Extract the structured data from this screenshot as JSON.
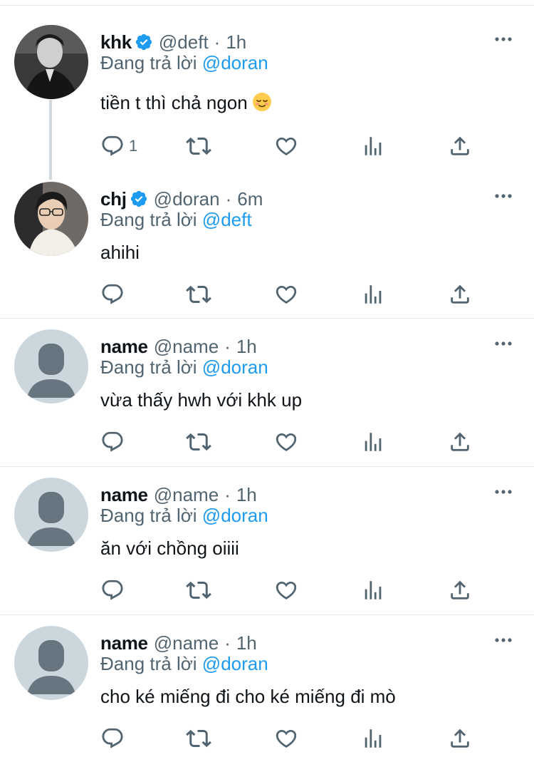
{
  "tweets": [
    {
      "display_name": "khk",
      "verified": true,
      "handle": "@deft",
      "separator": "·",
      "time": "1h",
      "reply_prefix": "Đang trả lời",
      "reply_to": "@doran",
      "text": "tiền t thì chả ngon",
      "emoji": "relieved-face",
      "reply_count": "1"
    },
    {
      "display_name": "chj",
      "verified": true,
      "handle": "@doran",
      "separator": "·",
      "time": "6m",
      "reply_prefix": "Đang trả lời",
      "reply_to": "@deft",
      "text": "ahihi",
      "reply_count": ""
    },
    {
      "display_name": "name",
      "verified": false,
      "handle": "@name",
      "separator": "·",
      "time": "1h",
      "reply_prefix": "Đang trả lời",
      "reply_to": "@doran",
      "text": "vừa thấy hwh với khk up",
      "reply_count": ""
    },
    {
      "display_name": "name",
      "verified": false,
      "handle": "@name",
      "separator": "·",
      "time": "1h",
      "reply_prefix": "Đang trả lời",
      "reply_to": "@doran",
      "text": "ăn với chồng oiiii",
      "reply_count": ""
    },
    {
      "display_name": "name",
      "verified": false,
      "handle": "@name",
      "separator": "·",
      "time": "1h",
      "reply_prefix": "Đang trả lời",
      "reply_to": "@doran",
      "text": "cho ké miếng đi cho ké miếng đi mò",
      "reply_count": ""
    }
  ],
  "icons": {
    "actions": [
      "reply-icon",
      "retweet-icon",
      "like-icon",
      "analytics-icon",
      "share-icon"
    ],
    "more": "more-icon",
    "verified": "verified-badge-icon"
  },
  "colors": {
    "accent": "#1d9bf0",
    "text_primary": "#0f1419",
    "text_secondary": "#536471",
    "divider": "#e6e9ec",
    "default_avatar_bg": "#ccd6dd",
    "default_avatar_fg": "#66757f"
  }
}
